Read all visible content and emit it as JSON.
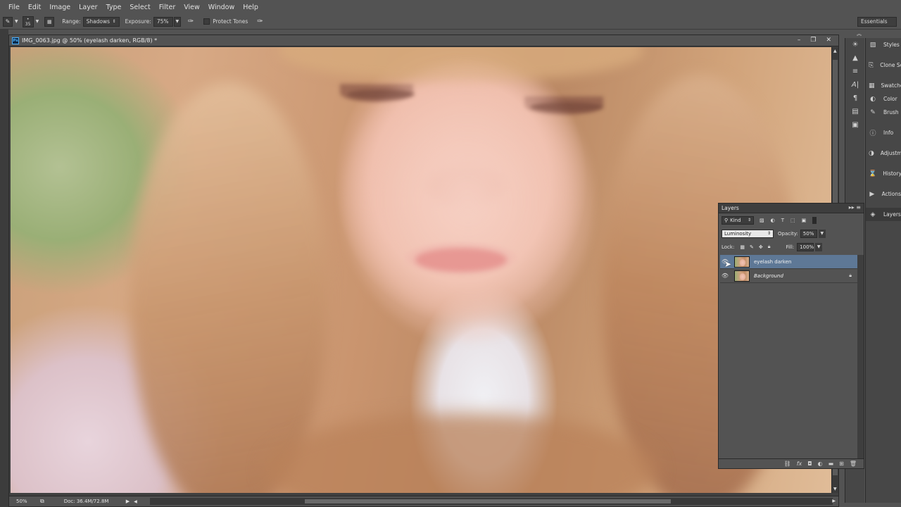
{
  "menubar": [
    "File",
    "Edit",
    "Image",
    "Layer",
    "Type",
    "Select",
    "Filter",
    "View",
    "Window",
    "Help"
  ],
  "options_bar": {
    "brush_size": "35",
    "range_label": "Range:",
    "range_value": "Shadows",
    "exposure_label": "Exposure:",
    "exposure_value": "75%",
    "protect_tones_label": "Protect Tones",
    "protect_tones_checked": false,
    "workspace": "Essentials"
  },
  "document": {
    "ps_badge": "Ps",
    "tab_title": "IMG_0063.jpg @ 50% (eyelash darken, RGB/8) *",
    "zoom": "50%",
    "doc_size": "Doc: 36.4M/72.8M"
  },
  "right_panels": [
    "Styles",
    "Clone Sc",
    "Swatche",
    "Color",
    "Brush",
    "Info",
    "Adjustm",
    "History",
    "Actions",
    "Layers"
  ],
  "layers_panel": {
    "title": "Layers",
    "filter_kind": "Kind",
    "blend_mode": "Luminosity",
    "opacity_label": "Opacity:",
    "opacity_value": "50%",
    "lock_label": "Lock:",
    "fill_label": "Fill:",
    "fill_value": "100%",
    "layers": [
      {
        "name": "eyelash darken",
        "selected": true,
        "locked": false,
        "visible": true
      },
      {
        "name": "Background",
        "selected": false,
        "locked": true,
        "visible": true
      }
    ]
  },
  "colors": {
    "selection": "#5e7896",
    "panel": "#535353",
    "dark": "#3c3c3c"
  }
}
